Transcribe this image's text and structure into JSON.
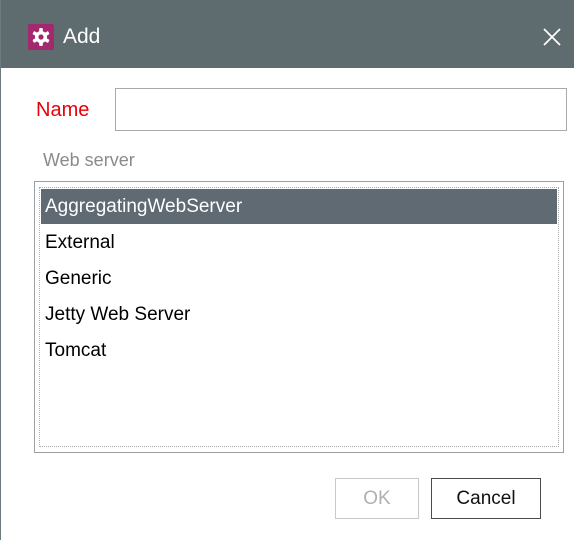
{
  "window": {
    "title": "Add",
    "app_icon": "gear-icon",
    "close_icon": "close-icon"
  },
  "form": {
    "name_label": "Name",
    "name_value": "",
    "section_label": "Web server"
  },
  "web_servers": {
    "selected": "AggregatingWebServer",
    "items": [
      {
        "label": "AggregatingWebServer"
      },
      {
        "label": "External"
      },
      {
        "label": "Generic"
      },
      {
        "label": "Jetty Web Server"
      },
      {
        "label": "Tomcat"
      }
    ]
  },
  "buttons": {
    "ok_label": "OK",
    "cancel_label": "Cancel"
  },
  "colors": {
    "titlebar": "#5f6c6f",
    "app_icon_bg": "#a3286e",
    "name_label": "#e8000b",
    "selection": "#5f6a73"
  }
}
